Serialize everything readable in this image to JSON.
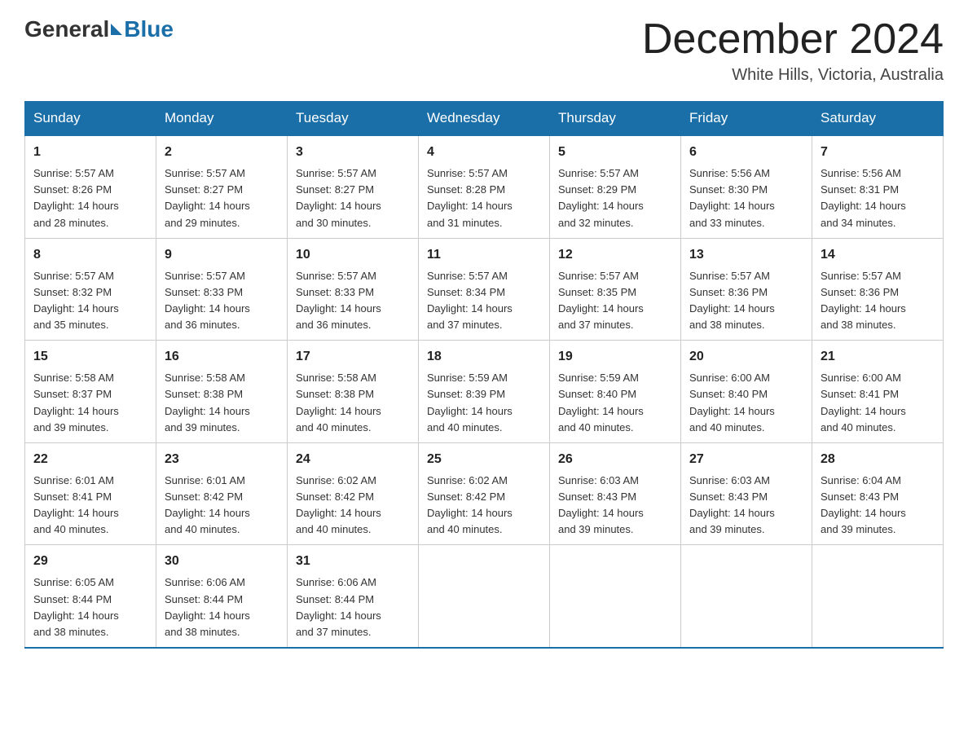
{
  "header": {
    "logo": {
      "general": "General",
      "blue": "Blue"
    },
    "title": "December 2024",
    "location": "White Hills, Victoria, Australia"
  },
  "weekdays": [
    "Sunday",
    "Monday",
    "Tuesday",
    "Wednesday",
    "Thursday",
    "Friday",
    "Saturday"
  ],
  "weeks": [
    [
      {
        "day": "1",
        "sunrise": "5:57 AM",
        "sunset": "8:26 PM",
        "daylight": "14 hours and 28 minutes."
      },
      {
        "day": "2",
        "sunrise": "5:57 AM",
        "sunset": "8:27 PM",
        "daylight": "14 hours and 29 minutes."
      },
      {
        "day": "3",
        "sunrise": "5:57 AM",
        "sunset": "8:27 PM",
        "daylight": "14 hours and 30 minutes."
      },
      {
        "day": "4",
        "sunrise": "5:57 AM",
        "sunset": "8:28 PM",
        "daylight": "14 hours and 31 minutes."
      },
      {
        "day": "5",
        "sunrise": "5:57 AM",
        "sunset": "8:29 PM",
        "daylight": "14 hours and 32 minutes."
      },
      {
        "day": "6",
        "sunrise": "5:56 AM",
        "sunset": "8:30 PM",
        "daylight": "14 hours and 33 minutes."
      },
      {
        "day": "7",
        "sunrise": "5:56 AM",
        "sunset": "8:31 PM",
        "daylight": "14 hours and 34 minutes."
      }
    ],
    [
      {
        "day": "8",
        "sunrise": "5:57 AM",
        "sunset": "8:32 PM",
        "daylight": "14 hours and 35 minutes."
      },
      {
        "day": "9",
        "sunrise": "5:57 AM",
        "sunset": "8:33 PM",
        "daylight": "14 hours and 36 minutes."
      },
      {
        "day": "10",
        "sunrise": "5:57 AM",
        "sunset": "8:33 PM",
        "daylight": "14 hours and 36 minutes."
      },
      {
        "day": "11",
        "sunrise": "5:57 AM",
        "sunset": "8:34 PM",
        "daylight": "14 hours and 37 minutes."
      },
      {
        "day": "12",
        "sunrise": "5:57 AM",
        "sunset": "8:35 PM",
        "daylight": "14 hours and 37 minutes."
      },
      {
        "day": "13",
        "sunrise": "5:57 AM",
        "sunset": "8:36 PM",
        "daylight": "14 hours and 38 minutes."
      },
      {
        "day": "14",
        "sunrise": "5:57 AM",
        "sunset": "8:36 PM",
        "daylight": "14 hours and 38 minutes."
      }
    ],
    [
      {
        "day": "15",
        "sunrise": "5:58 AM",
        "sunset": "8:37 PM",
        "daylight": "14 hours and 39 minutes."
      },
      {
        "day": "16",
        "sunrise": "5:58 AM",
        "sunset": "8:38 PM",
        "daylight": "14 hours and 39 minutes."
      },
      {
        "day": "17",
        "sunrise": "5:58 AM",
        "sunset": "8:38 PM",
        "daylight": "14 hours and 40 minutes."
      },
      {
        "day": "18",
        "sunrise": "5:59 AM",
        "sunset": "8:39 PM",
        "daylight": "14 hours and 40 minutes."
      },
      {
        "day": "19",
        "sunrise": "5:59 AM",
        "sunset": "8:40 PM",
        "daylight": "14 hours and 40 minutes."
      },
      {
        "day": "20",
        "sunrise": "6:00 AM",
        "sunset": "8:40 PM",
        "daylight": "14 hours and 40 minutes."
      },
      {
        "day": "21",
        "sunrise": "6:00 AM",
        "sunset": "8:41 PM",
        "daylight": "14 hours and 40 minutes."
      }
    ],
    [
      {
        "day": "22",
        "sunrise": "6:01 AM",
        "sunset": "8:41 PM",
        "daylight": "14 hours and 40 minutes."
      },
      {
        "day": "23",
        "sunrise": "6:01 AM",
        "sunset": "8:42 PM",
        "daylight": "14 hours and 40 minutes."
      },
      {
        "day": "24",
        "sunrise": "6:02 AM",
        "sunset": "8:42 PM",
        "daylight": "14 hours and 40 minutes."
      },
      {
        "day": "25",
        "sunrise": "6:02 AM",
        "sunset": "8:42 PM",
        "daylight": "14 hours and 40 minutes."
      },
      {
        "day": "26",
        "sunrise": "6:03 AM",
        "sunset": "8:43 PM",
        "daylight": "14 hours and 39 minutes."
      },
      {
        "day": "27",
        "sunrise": "6:03 AM",
        "sunset": "8:43 PM",
        "daylight": "14 hours and 39 minutes."
      },
      {
        "day": "28",
        "sunrise": "6:04 AM",
        "sunset": "8:43 PM",
        "daylight": "14 hours and 39 minutes."
      }
    ],
    [
      {
        "day": "29",
        "sunrise": "6:05 AM",
        "sunset": "8:44 PM",
        "daylight": "14 hours and 38 minutes."
      },
      {
        "day": "30",
        "sunrise": "6:06 AM",
        "sunset": "8:44 PM",
        "daylight": "14 hours and 38 minutes."
      },
      {
        "day": "31",
        "sunrise": "6:06 AM",
        "sunset": "8:44 PM",
        "daylight": "14 hours and 37 minutes."
      },
      null,
      null,
      null,
      null
    ]
  ],
  "labels": {
    "sunrise": "Sunrise:",
    "sunset": "Sunset:",
    "daylight": "Daylight:"
  }
}
